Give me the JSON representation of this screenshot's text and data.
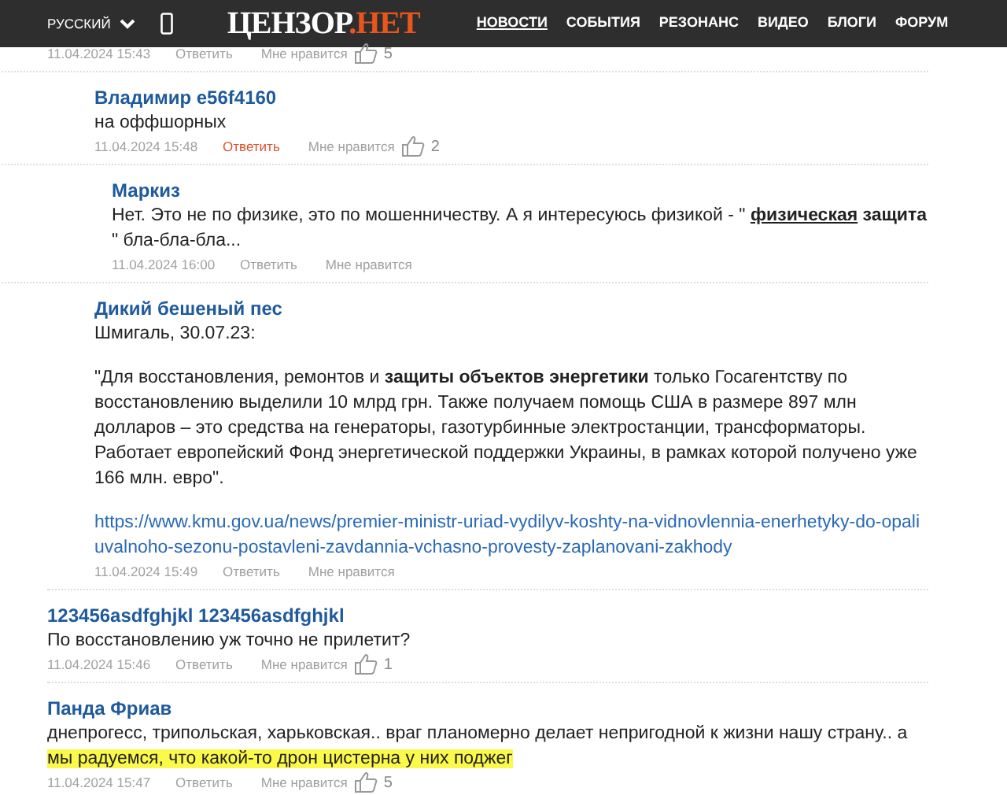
{
  "header": {
    "language": "РУССКИЙ",
    "logo_main": "ЦЕНЗОР",
    "logo_accent": ".НЕТ",
    "nav": [
      {
        "label": "НОВОСТИ",
        "selected": true
      },
      {
        "label": "СОБЫТИЯ",
        "selected": false
      },
      {
        "label": "РЕЗОНАНС",
        "selected": false
      },
      {
        "label": "ВИДЕО",
        "selected": false
      },
      {
        "label": "БЛОГИ",
        "selected": false
      },
      {
        "label": "ФОРУМ",
        "selected": false
      }
    ]
  },
  "comments": [
    {
      "date": "11.04.2024 15:43",
      "reply": "Ответить",
      "reply_active": false,
      "like": "Мне нравится",
      "likes": "5",
      "children": [
        {
          "author": "Владимир e56f4160",
          "paragraphs": [
            [
              {
                "kind": "plain",
                "text": "на оффшорных"
              }
            ]
          ],
          "date": "11.04.2024 15:48",
          "reply": "Ответить",
          "reply_active": true,
          "like": "Мне нравится",
          "likes": "2",
          "children": [
            {
              "author": "Маркиз",
              "paragraphs": [
                [
                  {
                    "kind": "plain",
                    "text": "Нет. Это не по физике, это по мошенничеству. А я интересуюсь физикой - \" "
                  },
                  {
                    "kind": "link",
                    "text": "физическая"
                  },
                  {
                    "kind": "bold",
                    "text": " защита"
                  },
                  {
                    "kind": "plain",
                    "text": " \" бла-бла-бла..."
                  }
                ]
              ],
              "date": "11.04.2024 16:00",
              "reply": "Ответить",
              "reply_active": false,
              "like": "Мне нравится"
            }
          ]
        },
        {
          "author": "Дикий бешеный пес",
          "paragraphs": [
            [
              {
                "kind": "plain",
                "text": "Шмигаль, 30.07.23:"
              }
            ],
            [
              {
                "kind": "plain",
                "text": "\"Для восстановления, ремонтов и "
              },
              {
                "kind": "bold",
                "text": "защиты объектов энергетики"
              },
              {
                "kind": "plain",
                "text": " только Госагентству по восстановлению выделили 10 млрд грн. Также получаем помощь США в размере 897 млн долларов – это средства на генераторы, газотурбинные электростанции, трансформаторы. Работает европейский Фонд энергетической поддержки Украины, в рамках которой получено уже 166 млн. евро\"."
              }
            ],
            [
              {
                "kind": "url",
                "text": "https://www.kmu.gov.ua/news/premier-ministr-uriad-vydilyv-koshty-na-vidnovlennia-enerhetyky-do-opaliuvalnoho-sezonu-postavleni-zavdannia-vchasno-provesty-zaplanovani-zakhody"
              }
            ]
          ],
          "date": "11.04.2024 15:49",
          "reply": "Ответить",
          "reply_active": false,
          "like": "Мне нравится"
        }
      ]
    },
    {
      "author": "123456asdfghjkl 123456asdfghjkl",
      "paragraphs": [
        [
          {
            "kind": "plain",
            "text": "По восстановлению уж точно не прилетит?"
          }
        ]
      ],
      "date": "11.04.2024 15:46",
      "reply": "Ответить",
      "reply_active": false,
      "like": "Мне нравится",
      "likes": "1"
    },
    {
      "author": "Панда Фриав",
      "paragraphs": [
        [
          {
            "kind": "plain",
            "text": "днепрогесс, трипольская, харьковская.. враг планомерно делает непригодной к жизни нашу страну.. а "
          },
          {
            "kind": "highlight",
            "text": "мы радуемся, что какой-то дрон цистерна у них поджег"
          }
        ]
      ],
      "date": "11.04.2024 15:47",
      "reply": "Ответить",
      "reply_active": false,
      "like": "Мне нравится",
      "likes": "5"
    }
  ]
}
